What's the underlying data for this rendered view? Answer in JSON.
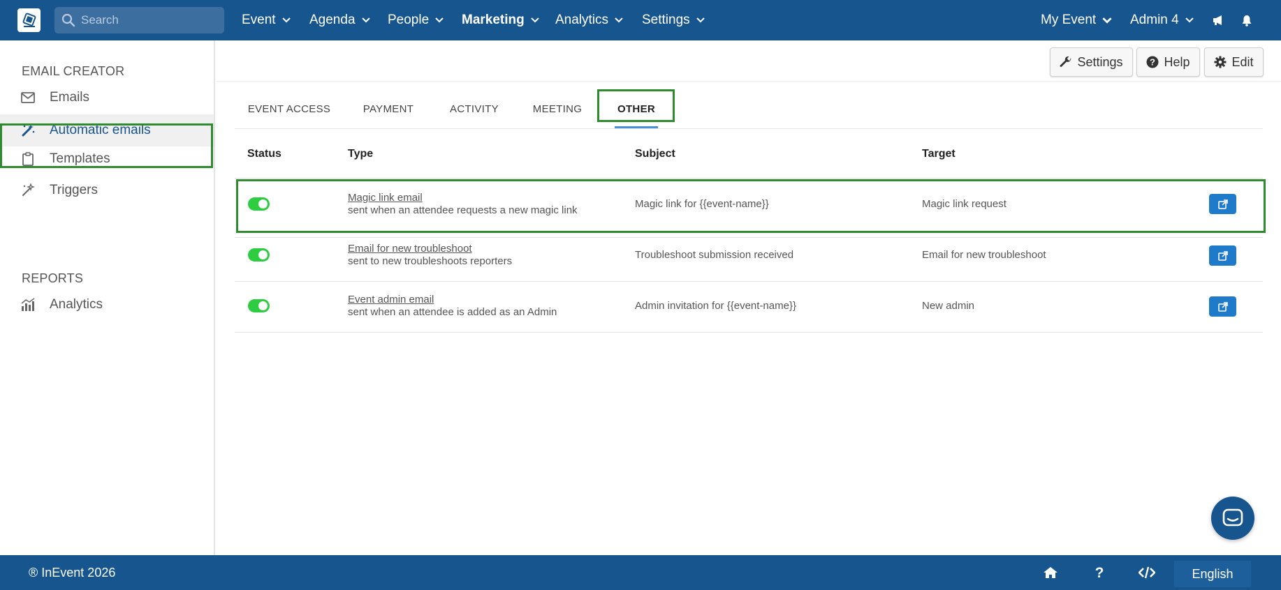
{
  "app": {
    "logo_text": "InEvent",
    "search": {
      "placeholder": "Search"
    },
    "nav": [
      {
        "label": "Event"
      },
      {
        "label": "Agenda"
      },
      {
        "label": "People"
      },
      {
        "label": "Marketing"
      },
      {
        "label": "Analytics"
      },
      {
        "label": "Settings"
      }
    ],
    "right": {
      "event_label": "My Event",
      "admin_label": "Admin 4"
    }
  },
  "sidebar": {
    "section1": "EMAIL CREATOR",
    "items": [
      {
        "label": "Emails"
      },
      {
        "label": "Automatic emails"
      },
      {
        "label": "Templates"
      },
      {
        "label": "Triggers"
      }
    ],
    "section2": "REPORTS",
    "reports": [
      {
        "label": "Analytics"
      }
    ]
  },
  "toolbar": {
    "settings_label": "Settings",
    "help_label": "Help",
    "edit_label": "Edit"
  },
  "tabs": [
    {
      "label": "EVENT ACCESS"
    },
    {
      "label": "PAYMENT"
    },
    {
      "label": "ACTIVITY"
    },
    {
      "label": "MEETING"
    },
    {
      "label": "OTHER"
    }
  ],
  "table": {
    "headers": {
      "status": "Status",
      "type": "Type",
      "subject": "Subject",
      "target": "Target"
    },
    "rows": [
      {
        "enabled": true,
        "type_title": "Magic link email",
        "type_desc": "sent when an attendee requests a new magic link",
        "subject": "Magic link for {{event-name}}",
        "target": "Magic link request"
      },
      {
        "enabled": true,
        "type_title": "Email for new troubleshoot",
        "type_desc": "sent to new troubleshoots reporters",
        "subject": "Troubleshoot submission received",
        "target": "Email for new troubleshoot"
      },
      {
        "enabled": true,
        "type_title": "Event admin email",
        "type_desc": "sent when an attendee is added as an Admin",
        "subject": "Admin invitation for {{event-name}}",
        "target": "New admin"
      }
    ]
  },
  "footer": {
    "copyright": "® InEvent 2026",
    "language": "English"
  },
  "colors": {
    "brand": "#17558f",
    "highlight": "#2e8b2e",
    "toggle_on": "#2ecc40",
    "edit_button": "#1f7ac9"
  }
}
